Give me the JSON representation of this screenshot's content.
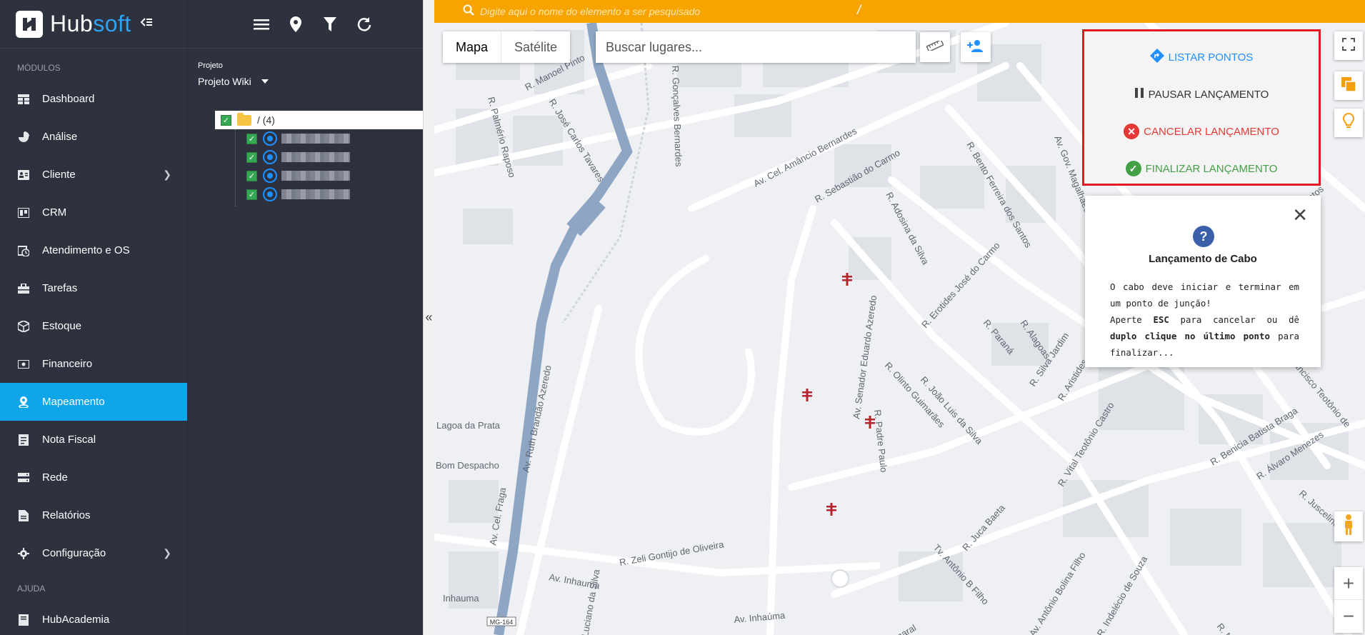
{
  "brand": {
    "name_part1": "Hub",
    "name_part2": "soft"
  },
  "sidebar": {
    "section_modules": "MÓDULOS",
    "section_help": "AJUDA",
    "items": [
      {
        "label": "Dashboard",
        "icon": "table-icon"
      },
      {
        "label": "Análise",
        "icon": "pie-chart-icon"
      },
      {
        "label": "Cliente",
        "icon": "contact-card-icon"
      },
      {
        "label": "CRM",
        "icon": "board-icon"
      },
      {
        "label": "Atendimento e OS",
        "icon": "calendar-clock-icon"
      },
      {
        "label": "Tarefas",
        "icon": "toolbox-icon"
      },
      {
        "label": "Estoque",
        "icon": "box-icon"
      },
      {
        "label": "Financeiro",
        "icon": "money-icon"
      },
      {
        "label": "Mapeamento",
        "icon": "map-pin-icon"
      },
      {
        "label": "Nota Fiscal",
        "icon": "invoice-icon"
      },
      {
        "label": "Rede",
        "icon": "server-icon"
      },
      {
        "label": "Relatórios",
        "icon": "report-icon"
      },
      {
        "label": "Configuração",
        "icon": "gear-icon"
      }
    ],
    "help_items": [
      {
        "label": "HubAcademia",
        "icon": "book-icon"
      }
    ]
  },
  "tree": {
    "project_label": "Projeto",
    "project_value": "Projeto Wiki",
    "root_label": "/ (4)"
  },
  "map": {
    "search_placeholder": "Digite aqui o nome do elemento a ser pesquisado",
    "search_slash": "/",
    "type_map": "Mapa",
    "type_satellite": "Satélite",
    "places_placeholder": "Buscar lugares...",
    "attribution_tag": "MG-164",
    "streets": [
      "R. Manoel Pinto",
      "R. José Carlos Tavares",
      "R. Palmério Raposo",
      "R. Gonçalves Bernardes",
      "Av. Cel. Amâncio Bernardes",
      "R. Sebastião do Carmo",
      "R. Adosina da Silva",
      "R. Bento Ferreira dos Santos",
      "Av. Gov. Magalhães",
      "R. Erotides José do Carmo",
      "Av. Senador Eduardo Azeredo",
      "Av. Ruth Brandão Azeredo",
      "Lagoa da Prata",
      "Bom Despacho",
      "Av. Cel. Fraga",
      "R. Padre Paulo",
      "R. Zeli Gontijo de Oliveira",
      "Av. Inhauma",
      "Inhauma",
      "Av. Inhaúma",
      "R. Paraná",
      "R. Alagoas",
      "R. Silva Jardim",
      "R. Olinto Guimarães",
      "R. João Luis da Silva",
      "R. Vital Teotônio Castro",
      "R. Juca Baeta",
      "Av. Antônio Bolina Filho",
      "R. Indelécio de Souza",
      "R. Benicia Batista Braga",
      "R. Álvaro Menezes",
      "R. Juscelino",
      "Tv. Antônio B Filho",
      "R. Aristides Cabral",
      "R. Nico",
      "Luciano da Silva",
      "Francisco Teotônio de",
      "Amaral",
      "Santos"
    ]
  },
  "actions": {
    "list_points": "LISTAR PONTOS",
    "pause": "PAUSAR LANÇAMENTO",
    "cancel": "CANCELAR LANÇAMENTO",
    "finish": "FINALIZAR LANÇAMENTO"
  },
  "help_card": {
    "title": "Lançamento de Cabo",
    "line1": "O cabo deve iniciar e terminar em um ponto de junção!",
    "line2_a": "Aperte ",
    "line2_key": "ESC",
    "line2_b": " para cancelar ou dê ",
    "line2_bold": "duplo clique no último ponto",
    "line2_c": " para finalizar..."
  },
  "colors": {
    "accent": "#0ea5e9",
    "search_bar": "#f7a400",
    "highlight_border": "#e21b23",
    "cancel": "#e53935",
    "finish": "#43a047",
    "list": "#1e90ff"
  }
}
